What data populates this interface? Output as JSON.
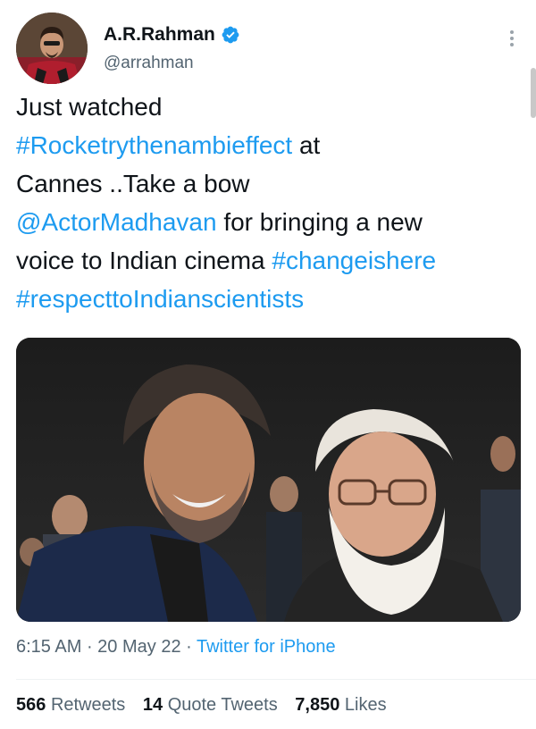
{
  "author": {
    "display_name": "A.R.Rahman",
    "handle": "@arrahman"
  },
  "tweet": {
    "line1": "Just watched",
    "hashtag1": "#Rocketrythenambieffect",
    "line2_tail": " at",
    "line3": "Cannes ..Take a bow",
    "mention": "@ActorMadhavan",
    "line4_tail": " for bringing a new",
    "line5": "voice to Indian cinema ",
    "hashtag2": "#changeishere",
    "hashtag3": "#respecttoIndianscientists"
  },
  "meta": {
    "time": "6:15 AM",
    "sep1": " · ",
    "date": "20 May 22",
    "sep2": " · ",
    "source": "Twitter for iPhone"
  },
  "stats": {
    "retweets_count": "566",
    "retweets_label": "Retweets",
    "quotes_count": "14",
    "quotes_label": "Quote Tweets",
    "likes_count": "7,850",
    "likes_label": "Likes"
  },
  "colors": {
    "link": "#1d9bf0",
    "text": "#0f1419",
    "secondary": "#536471",
    "verified": "#1d9bf0"
  },
  "icons": {
    "verified": "verified-badge-icon",
    "more": "more-options-icon"
  }
}
